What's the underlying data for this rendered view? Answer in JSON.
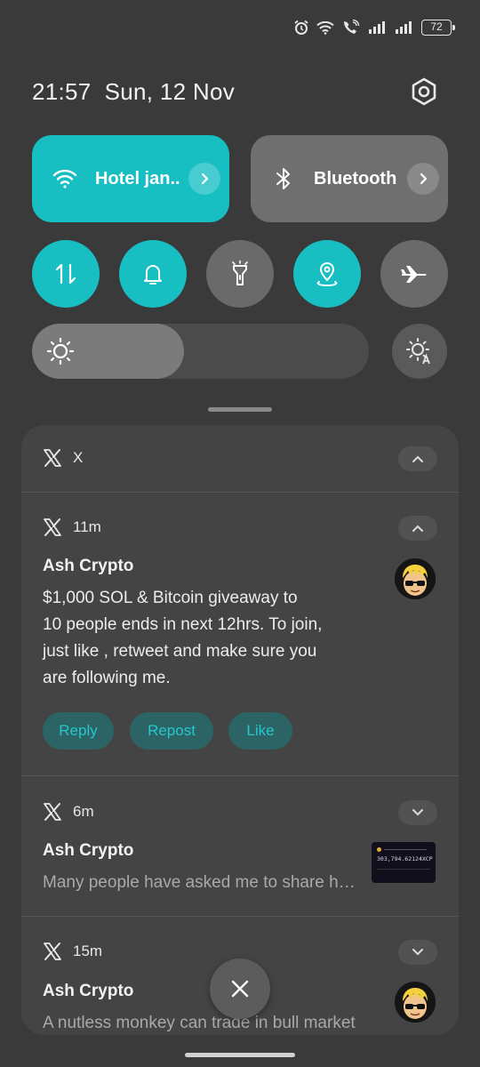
{
  "status_bar": {
    "battery_level": "72",
    "icons": [
      "alarm-icon",
      "wifi-icon",
      "volte-call-icon",
      "signal-icon",
      "signal-icon",
      "battery-icon"
    ]
  },
  "header": {
    "time": "21:57",
    "date": "Sun, 12 Nov",
    "settings_icon": "gear-icon"
  },
  "quick_tiles": [
    {
      "label": "Hotel jan..",
      "icon": "wifi-icon",
      "active": true
    },
    {
      "label": "Bluetooth",
      "icon": "bluetooth-icon",
      "active": false
    }
  ],
  "toggles": [
    {
      "icon": "mobile-data-icon",
      "active": true
    },
    {
      "icon": "bell-icon",
      "active": true
    },
    {
      "icon": "flashlight-icon",
      "active": false
    },
    {
      "icon": "location-icon",
      "active": true
    },
    {
      "icon": "airplane-icon",
      "active": false
    }
  ],
  "brightness": {
    "level": 0.45,
    "auto_icon": "auto-brightness-icon"
  },
  "notifications": {
    "group_app": "X",
    "items": [
      {
        "age": "11m",
        "sender": "Ash Crypto",
        "lines": [
          "$1,000 SOL & Bitcoin giveaway to",
          "10 people ends in next 12hrs. To join,",
          "just like , retweet and make sure you",
          "are following me."
        ],
        "actions": [
          "Reply",
          "Repost",
          "Like"
        ],
        "expanded": true
      },
      {
        "age": "6m",
        "sender": "Ash Crypto",
        "text": "Many people have asked me to share how I made this",
        "thumbnail_value": "303,794.62124XCP",
        "expanded": false
      },
      {
        "age": "15m",
        "sender": "Ash Crypto",
        "text": "A nutless monkey can trade in bull market",
        "expanded": false
      }
    ]
  },
  "accent_color": "#17bec2"
}
